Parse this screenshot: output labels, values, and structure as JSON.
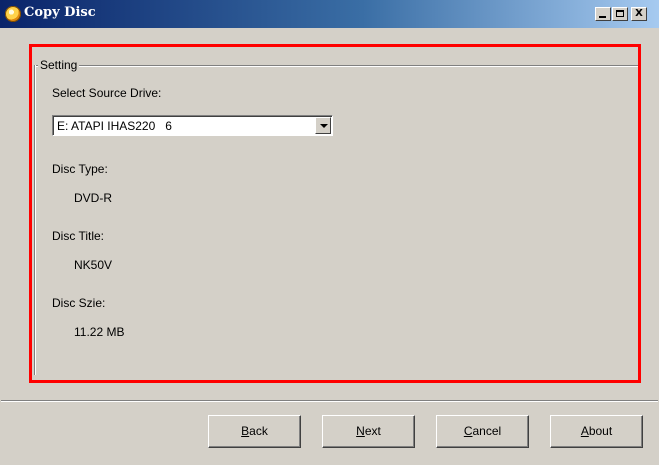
{
  "window": {
    "title": "Copy Disc",
    "controls": {
      "minimize": "_",
      "maximize": "□",
      "close": "X"
    }
  },
  "group": {
    "legend": "Setting"
  },
  "source": {
    "label": "Select Source Drive:",
    "selected": "E: ATAPI IHAS220   6"
  },
  "disc": {
    "type_label": "Disc Type:",
    "type_value": "DVD-R",
    "title_label": "Disc Title:",
    "title_value": "NK50V",
    "size_label": "Disc Szie:",
    "size_value": "11.22 MB"
  },
  "buttons": {
    "back": {
      "mnemonic": "B",
      "rest": "ack"
    },
    "next": {
      "mnemonic": "N",
      "rest": "ext"
    },
    "cancel": {
      "mnemonic": "C",
      "rest": "ancel"
    },
    "about": {
      "mnemonic": "A",
      "rest": "bout"
    }
  },
  "colors": {
    "highlight_border": "#ff0000",
    "dialog_background": "#d4d0c8",
    "titlebar_start": "#0a246a",
    "titlebar_end": "#a6caf0"
  }
}
